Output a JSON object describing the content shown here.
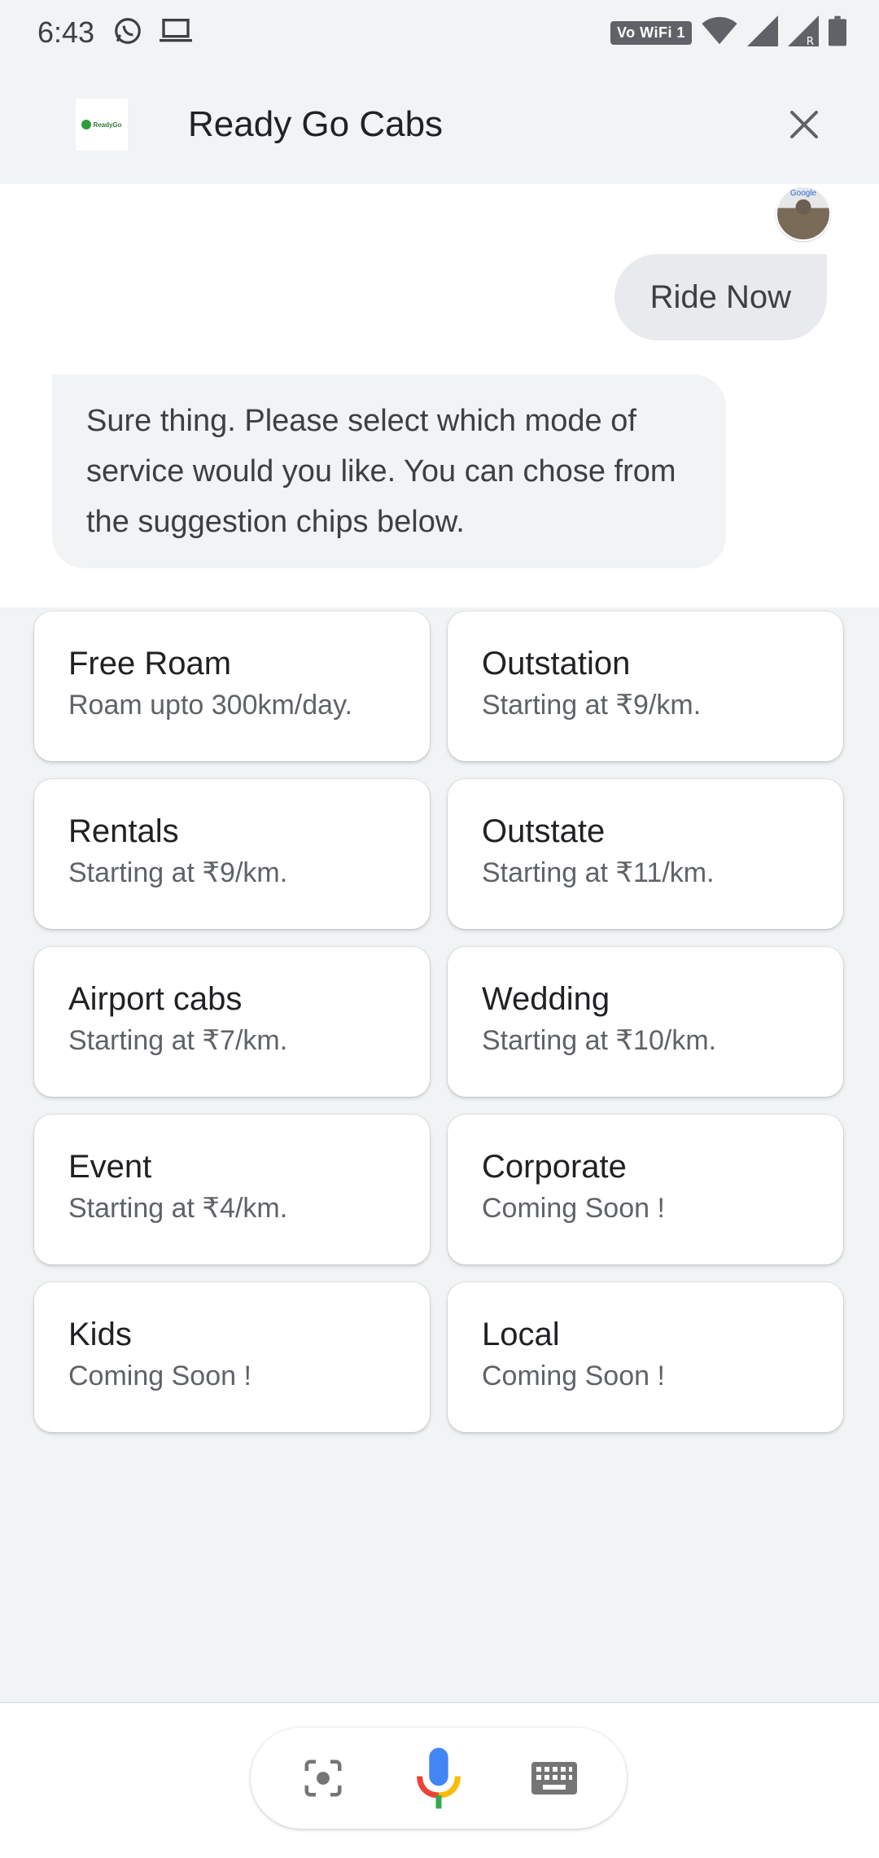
{
  "status_bar": {
    "time": "6:43",
    "volte_label": "Vo WiFi 1",
    "icons": [
      "whatsapp-icon",
      "laptop-icon",
      "wifi-icon",
      "signal-icon",
      "signal-roaming-icon",
      "battery-icon"
    ]
  },
  "app_bar": {
    "logo_text": "ReadyGo",
    "title": "Ready Go Cabs"
  },
  "conversation": {
    "avatar_label": "Google",
    "user_message": "Ride Now",
    "bot_message": "Sure thing. Please select which mode of service would you like. You can chose from the suggestion chips below."
  },
  "chips": [
    {
      "title": "Free Roam",
      "subtitle": "Roam upto 300km/day."
    },
    {
      "title": "Outstation",
      "subtitle": "Starting at ₹9/km."
    },
    {
      "title": "Rentals",
      "subtitle": "Starting at ₹9/km."
    },
    {
      "title": "Outstate",
      "subtitle": "Starting at ₹11/km."
    },
    {
      "title": "Airport cabs",
      "subtitle": "Starting at ₹7/km."
    },
    {
      "title": "Wedding",
      "subtitle": "Starting at ₹10/km."
    },
    {
      "title": "Event",
      "subtitle": "Starting at ₹4/km."
    },
    {
      "title": "Corporate",
      "subtitle": "Coming Soon !"
    },
    {
      "title": "Kids",
      "subtitle": "Coming Soon !"
    },
    {
      "title": "Local",
      "subtitle": "Coming Soon !"
    }
  ],
  "bottom_bar": {
    "icons": [
      "lens-icon",
      "microphone-icon",
      "keyboard-icon"
    ]
  },
  "colors": {
    "background": "#f1f3f4",
    "mic_blue": "#4285f4",
    "mic_red": "#ea4335",
    "mic_yellow": "#fbbc04",
    "mic_green": "#34a853"
  }
}
